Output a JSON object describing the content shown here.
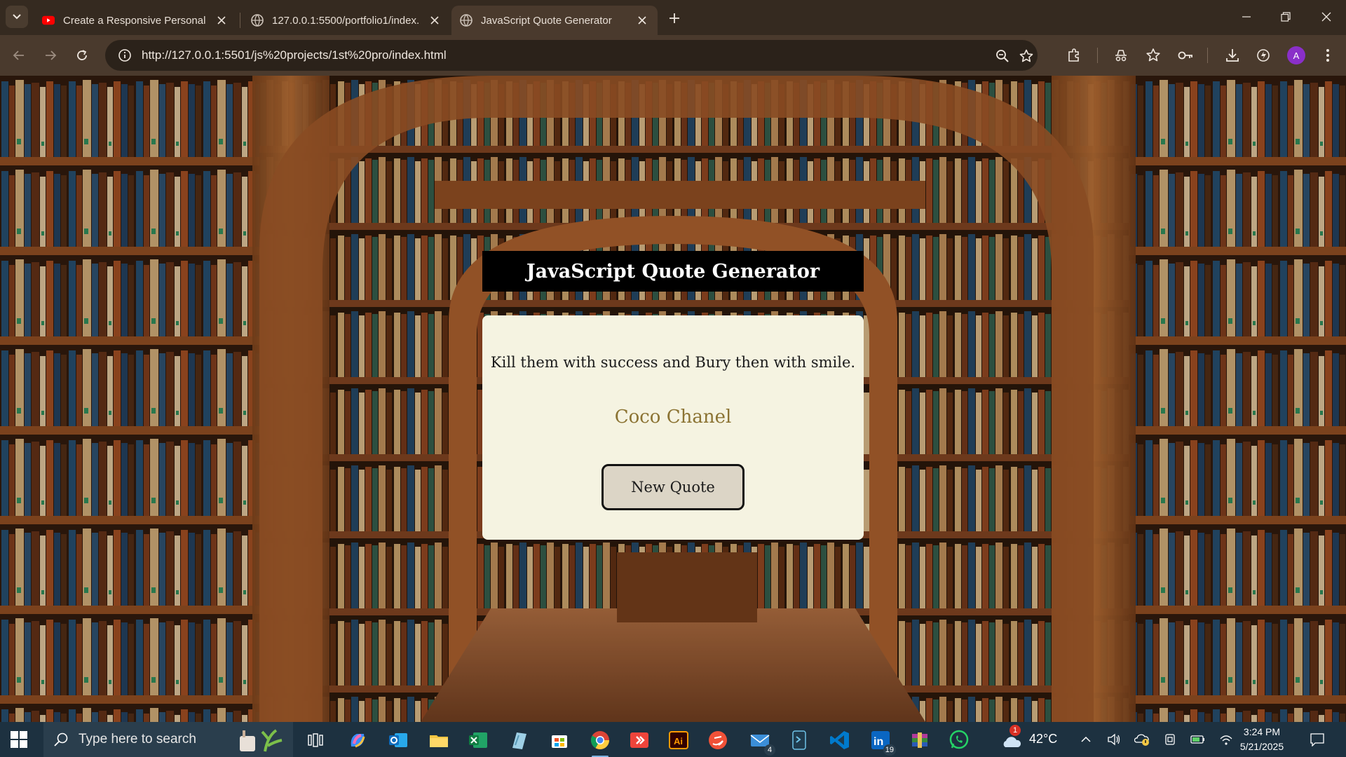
{
  "browser": {
    "tabs": [
      {
        "title": "Create a Responsive Personal Po",
        "favicon": "youtube-icon",
        "active": false
      },
      {
        "title": "127.0.0.1:5500/portfolio1/index.",
        "favicon": "globe-icon",
        "active": false
      },
      {
        "title": "JavaScript Quote Generator",
        "favicon": "globe-icon",
        "active": true
      }
    ],
    "url": "http://127.0.0.1:5501/js%20projects/1st%20pro/index.html",
    "profile_initial": "A",
    "theme": {
      "tabstrip": "#352a20",
      "toolbar": "#4a3a2d",
      "omnibox": "#2b221a"
    }
  },
  "app": {
    "title": "JavaScript Quote Generator",
    "quote": "Kill them with success and Bury then with smile.",
    "author": "Coco Chanel",
    "button_label": "New Quote",
    "colors": {
      "title_bg": "#000000",
      "card_bg": "#f5f3e1",
      "author": "#8b7333",
      "button_bg": "#dcd5c6"
    }
  },
  "taskbar": {
    "search_placeholder": "Type here to search",
    "apps": [
      "task-view-icon",
      "copilot-icon",
      "outlook-icon",
      "file-explorer-icon",
      "excel-icon",
      "notes-icon",
      "microsoft-store-icon",
      "chrome-icon",
      "anydesk-icon",
      "illustrator-icon",
      "swift-icon",
      "mail-icon",
      "terminal-icon",
      "vscode-icon",
      "linkedin-icon",
      "winrar-icon",
      "whatsapp-icon"
    ],
    "mail_badge": "4",
    "linkedin_badge": "19",
    "weather_badge": "1",
    "temperature": "42°C",
    "time": "3:24 PM",
    "date": "5/21/2025"
  }
}
